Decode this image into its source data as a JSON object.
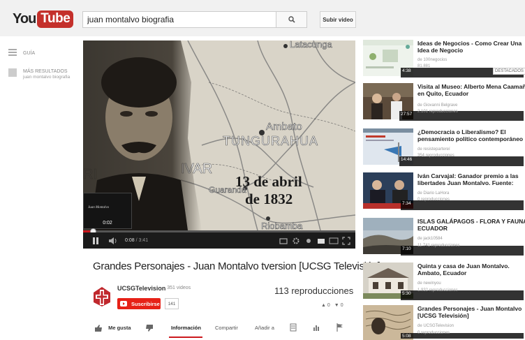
{
  "header": {
    "logo_you": "You",
    "logo_tube": "Tube",
    "search_value": "juan montalvo biografia",
    "upload_label": "Subir video"
  },
  "guide": {
    "guide_label": "GUÍA",
    "more_results_label": "MÁS RESULTADOS",
    "more_results_query": "juan montalvo biografia"
  },
  "player": {
    "overlay_line1": "13 de abril",
    "overlay_line2": "de 1832",
    "map_labels": [
      "Latacunga",
      "Ambato",
      "TUNGURAHUA",
      "IVAR",
      "Guaranda",
      "Riobamba",
      "RI"
    ],
    "preview_title": "Juan Montalvo",
    "preview_time": "0:02",
    "current_time": "0:08",
    "duration": "3:41",
    "progress_fraction": 0.036
  },
  "video": {
    "title": "Grandes Personajes - Juan Montalvo tversion [UCSG Televisión]",
    "channel_name": "UCSGTelevision",
    "video_count": "· 351 videos",
    "subscribe_label": "Suscribirse",
    "subscriber_count": "141",
    "view_count": "113 reproducciones",
    "likes": "0",
    "dislikes": "0"
  },
  "actions": {
    "like_label": "Me gusta",
    "info_tab": "Información",
    "share_tab": "Compartir",
    "add_tab": "Añadir a"
  },
  "colors": {
    "brand_red": "#c4302b",
    "subscribe_red": "#e62117",
    "progress_red": "#cc181e"
  },
  "related": [
    {
      "title1": "Ideas de Negocios - Como Crear Una",
      "title2": "Idea de Negocio",
      "author": "de 100negocios",
      "views": "81.881",
      "duration": "4:38",
      "badge": "DESTACADOS"
    },
    {
      "title1": "Visita al Museo: Alberto Mena Caamaño",
      "title2": "en Quito, Ecuador",
      "author": "de Giovanni Belgrave",
      "views": "2.101 reproducciones",
      "duration": "27:57"
    },
    {
      "title1": "¿Democracia o Liberalismo? El",
      "title2": "pensamiento político contemporáneo",
      "author": "de resistepartereí",
      "views": "354 reproducciones",
      "duration": "14:46"
    },
    {
      "title1": "Iván Carvajal: Ganador premio a las",
      "title2": "libertades Juan Montalvo. Fuente:",
      "author": "de Diario LaHora",
      "views": "0 reproducciones",
      "duration": "7:34"
    },
    {
      "title1": "ISLAS GALÁPAGOS - FLORA Y FAUNA",
      "title2": "ECUADOR",
      "author": "de jack10584",
      "views": "11.741 reproducciones",
      "duration": "7:10"
    },
    {
      "title1": "Quinta y casa de Juan Montalvo.",
      "title2": "Ambato, Ecuador",
      "author": "de newinyou",
      "views": "1.932 reproducciones",
      "duration": "5:30"
    },
    {
      "title1": "Grandes Personajes - Juan Montalvo",
      "title2": "[UCSG Televisión]",
      "author": "de UCSGTelevision",
      "views": "0 reproducciones",
      "duration": "5:08"
    }
  ]
}
